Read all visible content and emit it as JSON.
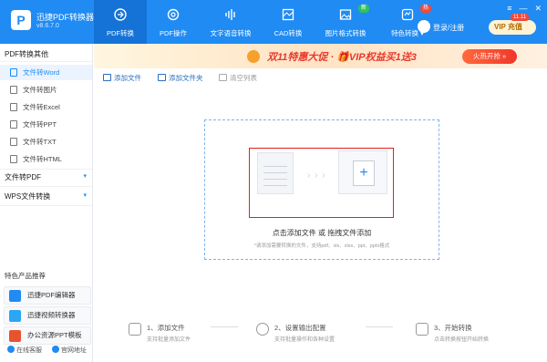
{
  "app": {
    "logo_letter": "P",
    "name": "迅捷PDF转换器",
    "version": "v8.6.7.0"
  },
  "nav": [
    {
      "label": "PDF转换",
      "icon": "convert-icon",
      "active": true
    },
    {
      "label": "PDF操作",
      "icon": "gear-icon"
    },
    {
      "label": "文字语音转换",
      "icon": "audio-wave-icon"
    },
    {
      "label": "CAD转换",
      "icon": "cad-icon"
    },
    {
      "label": "图片格式转换",
      "icon": "image-icon",
      "badge": "新"
    },
    {
      "label": "特色转换",
      "icon": "special-convert-icon",
      "badge": "热"
    }
  ],
  "header": {
    "login": "登录/注册",
    "vip_tag": "11.11",
    "vip_label": "VIP 充值",
    "window_controls": [
      "≡",
      "—",
      "✕"
    ]
  },
  "sidebar": {
    "group1_title": "PDF转换其他",
    "items": [
      {
        "label": "文件转Word",
        "active": true
      },
      {
        "label": "文件转图片"
      },
      {
        "label": "文件转Excel"
      },
      {
        "label": "文件转PPT"
      },
      {
        "label": "文件转TXT"
      },
      {
        "label": "文件转HTML"
      }
    ],
    "group2_title": "文件转PDF",
    "group3_title": "WPS文件转换",
    "recommend_title": "特色产品推荐",
    "recommend": [
      {
        "label": "迅捷PDF编辑器",
        "color": "#1f8bf3"
      },
      {
        "label": "迅捷视频转换器",
        "color": "#2aa6f5"
      },
      {
        "label": "办公资源PPT模板",
        "color": "#e8532f"
      }
    ],
    "footer": [
      "在线客服",
      "官网地址"
    ]
  },
  "banner": {
    "text": "双11特惠大促 · 🎁VIP权益买1送3",
    "button": "火热开抢 »"
  },
  "toolbar": {
    "add_file": "添加文件",
    "add_folder": "添加文件夹",
    "clear_list": "清空列表"
  },
  "dropzone": {
    "arrows": "› › ›",
    "plus": "+",
    "title": "点击添加文件 或 拖拽文件添加",
    "subtitle": "*请添加需要转换的文件，支持pdf、xls、xlsx、ppt、pptx格式"
  },
  "steps": [
    {
      "title": "1、添加文件",
      "desc": "支持批量添加文件"
    },
    {
      "title": "2、设置输出配置",
      "desc": "支持批量操作和各种设置"
    },
    {
      "title": "3、开始转换",
      "desc": "点击转换按钮开始转换"
    }
  ]
}
